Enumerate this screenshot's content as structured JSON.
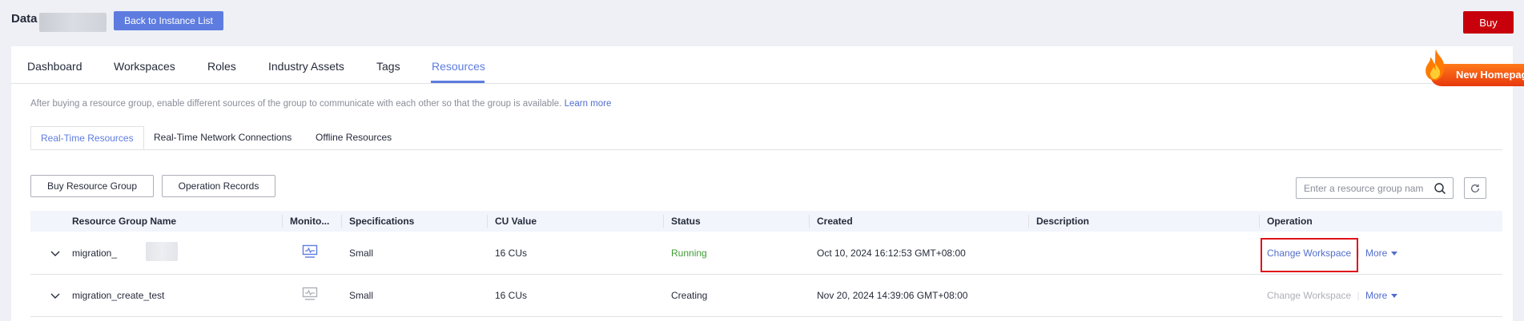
{
  "header": {
    "title": "Data",
    "back_button": "Back to Instance List",
    "buy_button": "Buy"
  },
  "promo": {
    "label": "New Homepage"
  },
  "main_tabs": [
    "Dashboard",
    "Workspaces",
    "Roles",
    "Industry Assets",
    "Tags",
    "Resources"
  ],
  "active_main_tab": "Resources",
  "hint": {
    "text": "After buying a resource group, enable different sources of the group to communicate with each other so that the group is available.",
    "link": "Learn more"
  },
  "sub_tabs": [
    "Real-Time Resources",
    "Real-Time Network Connections",
    "Offline Resources"
  ],
  "active_sub_tab": "Real-Time Resources",
  "toolbar": {
    "buy_resource_group": "Buy Resource Group",
    "operation_records": "Operation Records",
    "search_placeholder": "Enter a resource group name"
  },
  "table": {
    "columns": [
      "Resource Group Name",
      "Monito...",
      "Specifications",
      "CU Value",
      "Status",
      "Created",
      "Description",
      "Operation"
    ],
    "rows": [
      {
        "name": "migration_",
        "specifications": "Small",
        "cu_value": "16 CUs",
        "status": "Running",
        "created": "Oct 10, 2024 16:12:53 GMT+08:00",
        "description": "",
        "op_primary": "Change Workspace",
        "op_more": "More"
      },
      {
        "name": "migration_create_test",
        "specifications": "Small",
        "cu_value": "16 CUs",
        "status": "Creating",
        "created": "Nov 20, 2024 14:39:06 GMT+08:00",
        "description": "",
        "op_primary": "Change Workspace",
        "op_more": "More"
      }
    ]
  },
  "colors": {
    "accent": "#5e7ce0",
    "buy": "#c7000b",
    "running": "#3f9b34",
    "highlight": "#e0101a"
  }
}
